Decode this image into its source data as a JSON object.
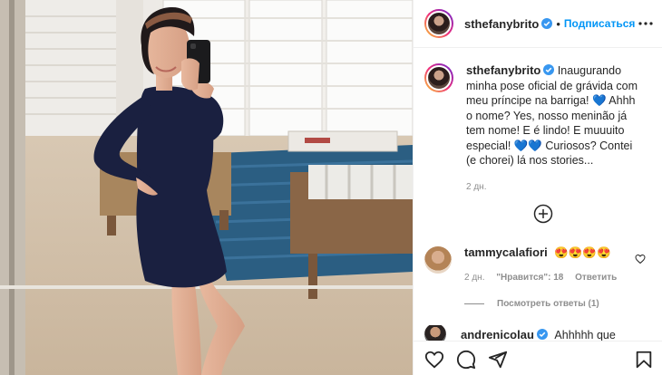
{
  "post": {
    "author": {
      "username": "sthefanybrito",
      "verified": true,
      "follow_label": "Подписаться",
      "separator": "•"
    },
    "caption": {
      "username": "sthefanybrito",
      "text": "Inaugurando minha pose oficial de grávida com meu príncipe na barriga! 💙 Ahhh o nome? Yes, nosso meninão já tem nome! E é lindo! E muuuito especial! 💙💙 Curiosos? Contei (e chorei) lá nos stories...",
      "time": "2 дн."
    },
    "comments": [
      {
        "username": "tammycalafiori",
        "text": "😍😍😍😍",
        "time": "2 дн.",
        "likes": "\"Нравится\": 18",
        "reply_label": "Ответить",
        "view_replies": "Посмотреть ответы (1)"
      },
      {
        "username": "andrenicolau",
        "verified": true,
        "text": "Ahhhhh que"
      }
    ]
  },
  "icons": {
    "more": "more-options-icon",
    "verified": "verified-badge-icon",
    "load_more": "plus-circle-icon",
    "like": "heart-icon",
    "comment": "comment-icon",
    "share": "share-icon",
    "save": "bookmark-icon"
  },
  "colors": {
    "link_blue": "#0095f6",
    "verified_blue": "#3897f0",
    "muted": "#8e8e8e",
    "dress": "#1a2040",
    "rug": "#2b5e82"
  }
}
